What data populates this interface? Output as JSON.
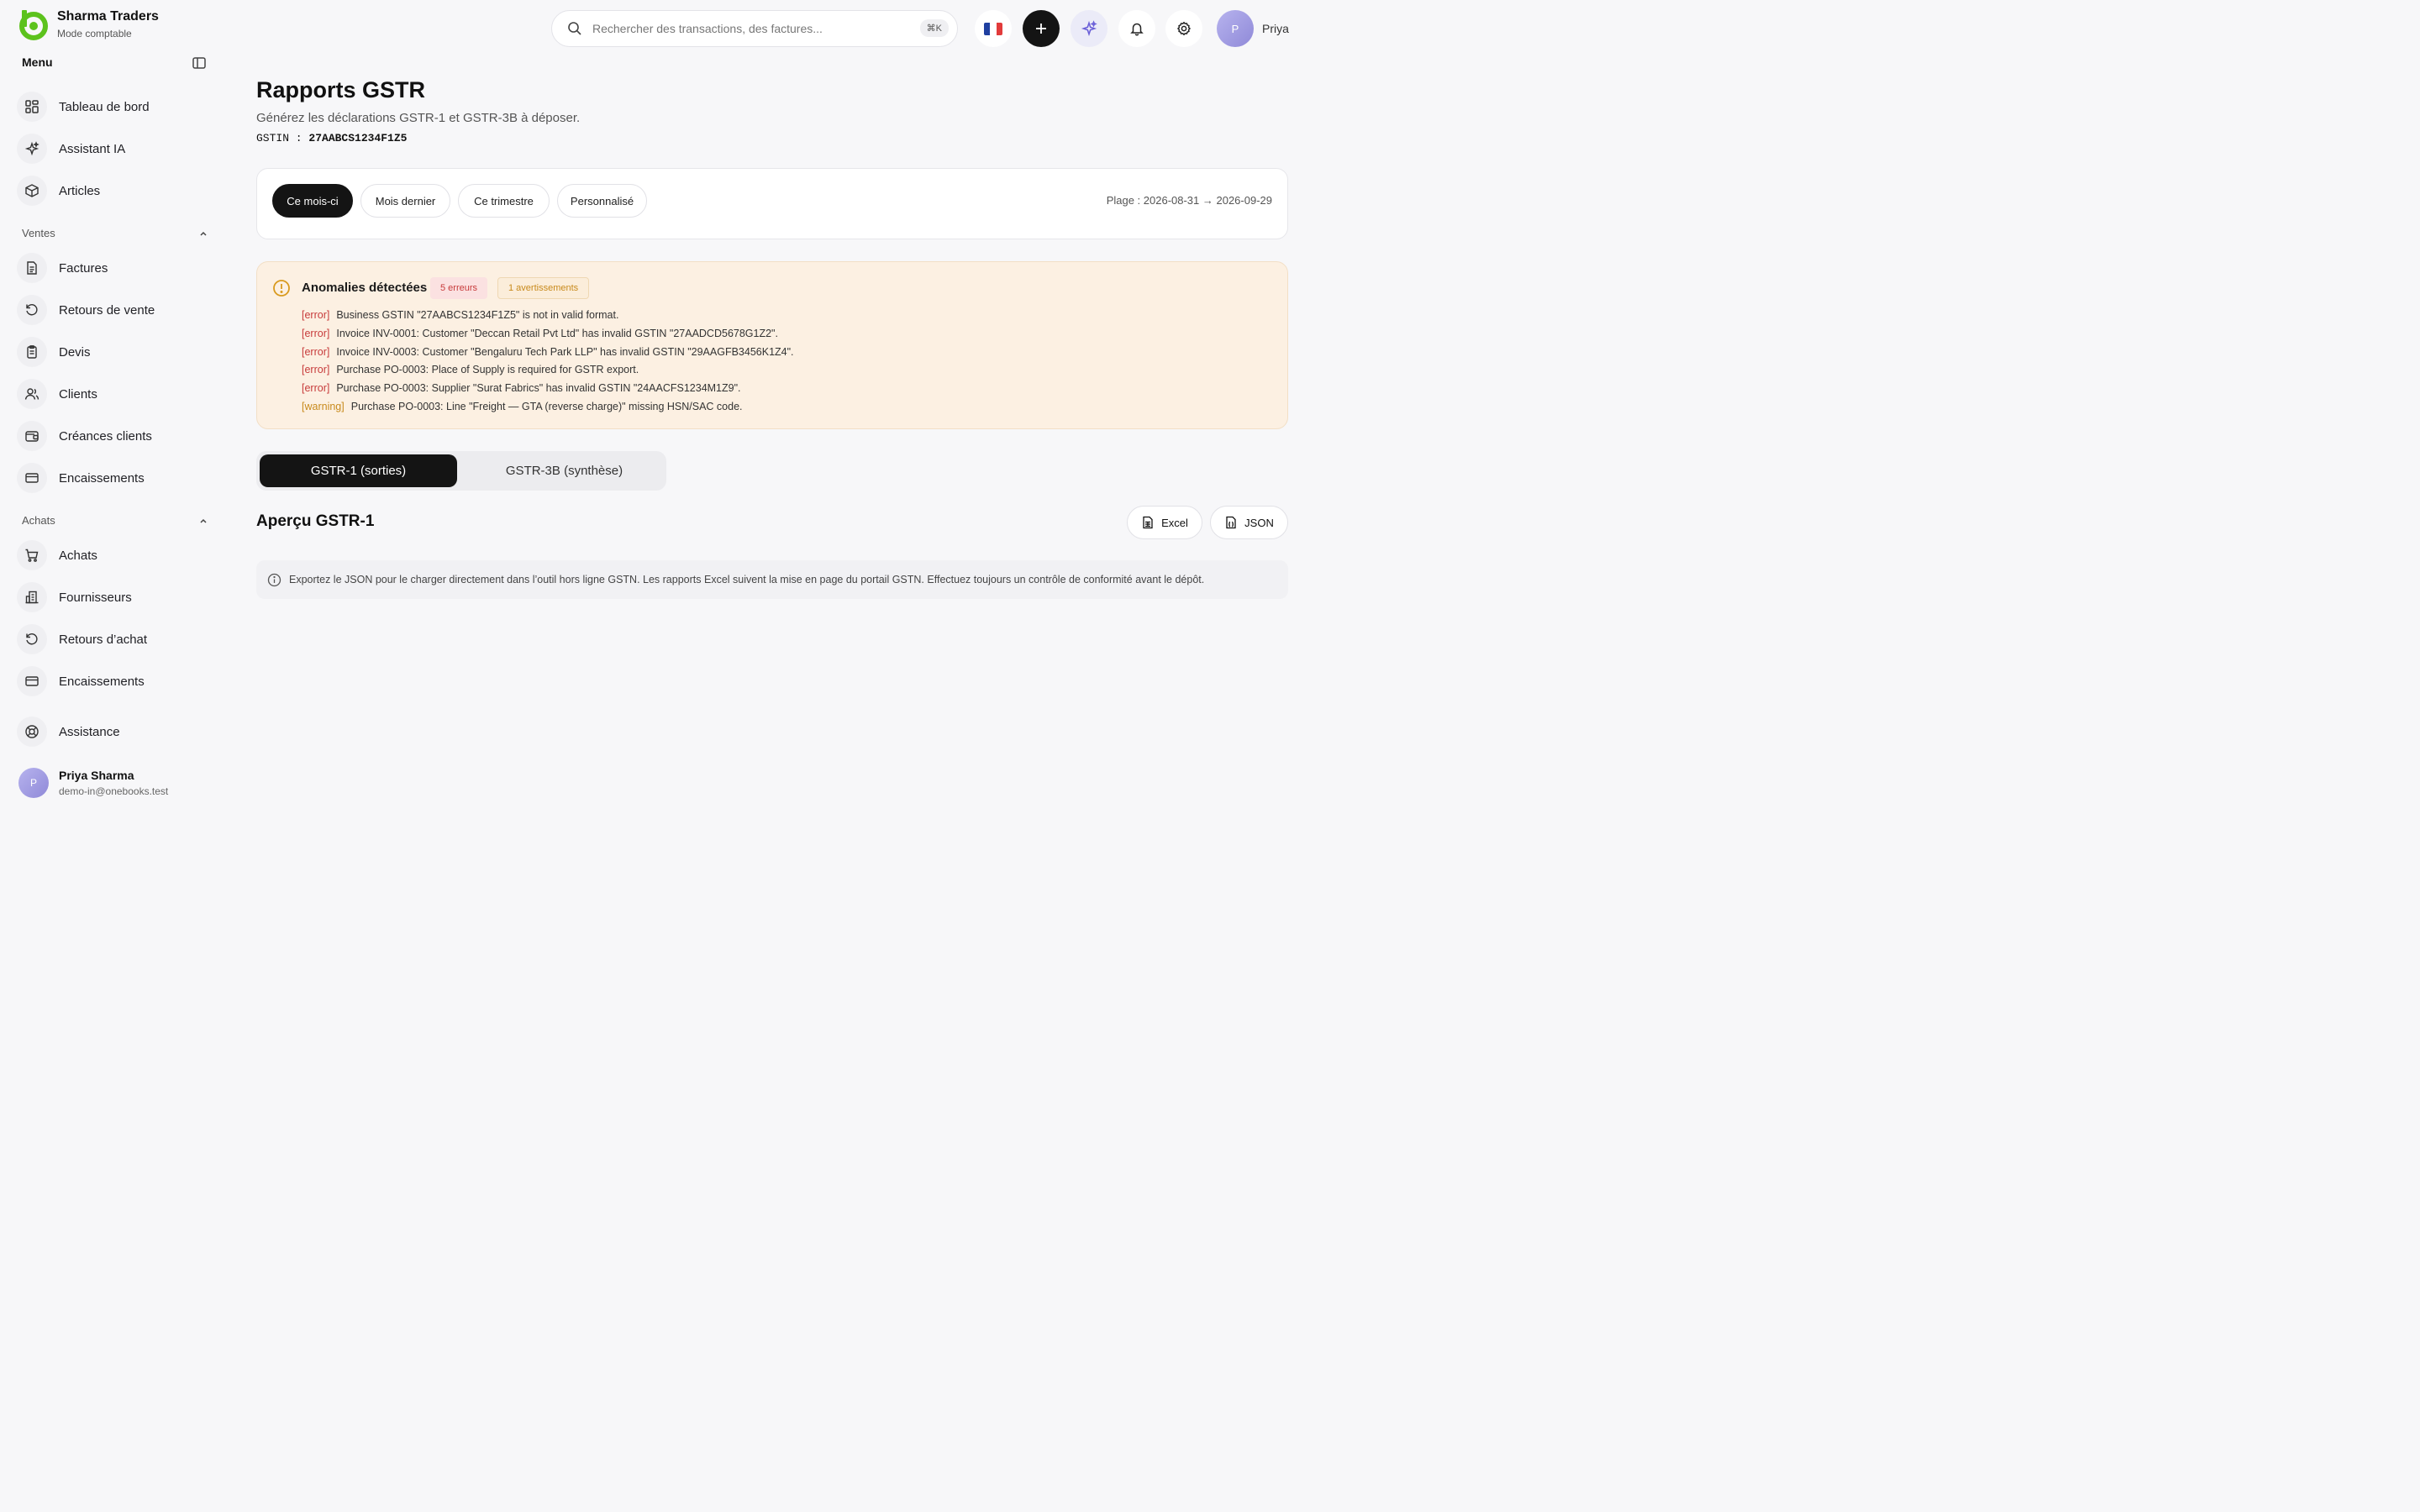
{
  "brand": {
    "name": "Sharma Traders",
    "mode": "Mode comptable"
  },
  "sidebar": {
    "menu_title": "Menu",
    "top_items": [
      {
        "label": "Tableau de bord",
        "icon": "dashboard-icon"
      },
      {
        "label": "Assistant IA",
        "icon": "sparkles-icon"
      },
      {
        "label": "Articles",
        "icon": "box-icon"
      }
    ],
    "sections": [
      {
        "title": "Ventes",
        "items": [
          {
            "label": "Factures",
            "icon": "document-icon"
          },
          {
            "label": "Retours de vente",
            "icon": "undo-icon"
          },
          {
            "label": "Devis",
            "icon": "clipboard-icon"
          },
          {
            "label": "Clients",
            "icon": "users-icon"
          },
          {
            "label": "Créances clients",
            "icon": "wallet-icon"
          },
          {
            "label": "Encaissements",
            "icon": "card-icon"
          }
        ]
      },
      {
        "title": "Achats",
        "items": [
          {
            "label": "Achats",
            "icon": "cart-icon"
          },
          {
            "label": "Fournisseurs",
            "icon": "building-icon"
          },
          {
            "label": "Retours d’achat",
            "icon": "undo-icon"
          },
          {
            "label": "Encaissements",
            "icon": "card-icon"
          }
        ]
      }
    ],
    "support": {
      "label": "Assistance",
      "icon": "lifebuoy-icon"
    },
    "user": {
      "initial": "P",
      "name": "Priya Sharma",
      "email": "demo-in@onebooks.test"
    }
  },
  "topbar": {
    "search_placeholder": "Rechercher des transactions, des factures...",
    "shortcut": "⌘K",
    "user_initial": "P",
    "user_name": "Priya",
    "flag_colors": [
      "#1f3fa0",
      "#ffffff",
      "#e23b3b"
    ]
  },
  "page": {
    "title": "Rapports GSTR",
    "subtitle": "Générez les déclarations GSTR-1 et GSTR-3B à déposer.",
    "gstin_label": "GSTIN :",
    "gstin_value": "27AABCS1234F1Z5"
  },
  "filters": {
    "chips": [
      "Ce mois-ci",
      "Mois dernier",
      "Ce trimestre",
      "Personnalisé"
    ],
    "active": 0,
    "range": "Plage : 2026-08-31 → 2026-09-29"
  },
  "anomalies": {
    "title": "Anomalies détectées",
    "errors_badge": "5 erreurs",
    "warnings_badge": "1 avertissements",
    "items": [
      {
        "level": "error",
        "tag": "[error]",
        "message": "Business GSTIN \"27AABCS1234F1Z5\" is not in valid format."
      },
      {
        "level": "error",
        "tag": "[error]",
        "message": "Invoice INV-0001: Customer \"Deccan Retail Pvt Ltd\" has invalid GSTIN \"27AADCD5678G1Z2\"."
      },
      {
        "level": "error",
        "tag": "[error]",
        "message": "Invoice INV-0003: Customer \"Bengaluru Tech Park LLP\" has invalid GSTIN \"29AAGFB3456K1Z4\"."
      },
      {
        "level": "error",
        "tag": "[error]",
        "message": "Purchase PO-0003: Place of Supply is required for GSTR export."
      },
      {
        "level": "error",
        "tag": "[error]",
        "message": "Purchase PO-0003: Supplier \"Surat Fabrics\" has invalid GSTIN \"24AACFS1234M1Z9\"."
      },
      {
        "level": "warning",
        "tag": "[warning]",
        "message": "Purchase PO-0003: Line \"Freight — GTA (reverse charge)\" missing HSN/SAC code."
      }
    ]
  },
  "tabs": {
    "items": [
      "GSTR-1 (sorties)",
      "GSTR-3B (synthèse)"
    ],
    "active": 0
  },
  "preview": {
    "title": "Aperçu GSTR-1",
    "export_excel": "Excel",
    "export_json": "JSON",
    "info": "Exportez le JSON pour le charger directement dans l’outil hors ligne GSTN. Les rapports Excel suivent la mise en page du portail GSTN. Effectuez toujours un contrôle de conformité avant le dépôt."
  }
}
